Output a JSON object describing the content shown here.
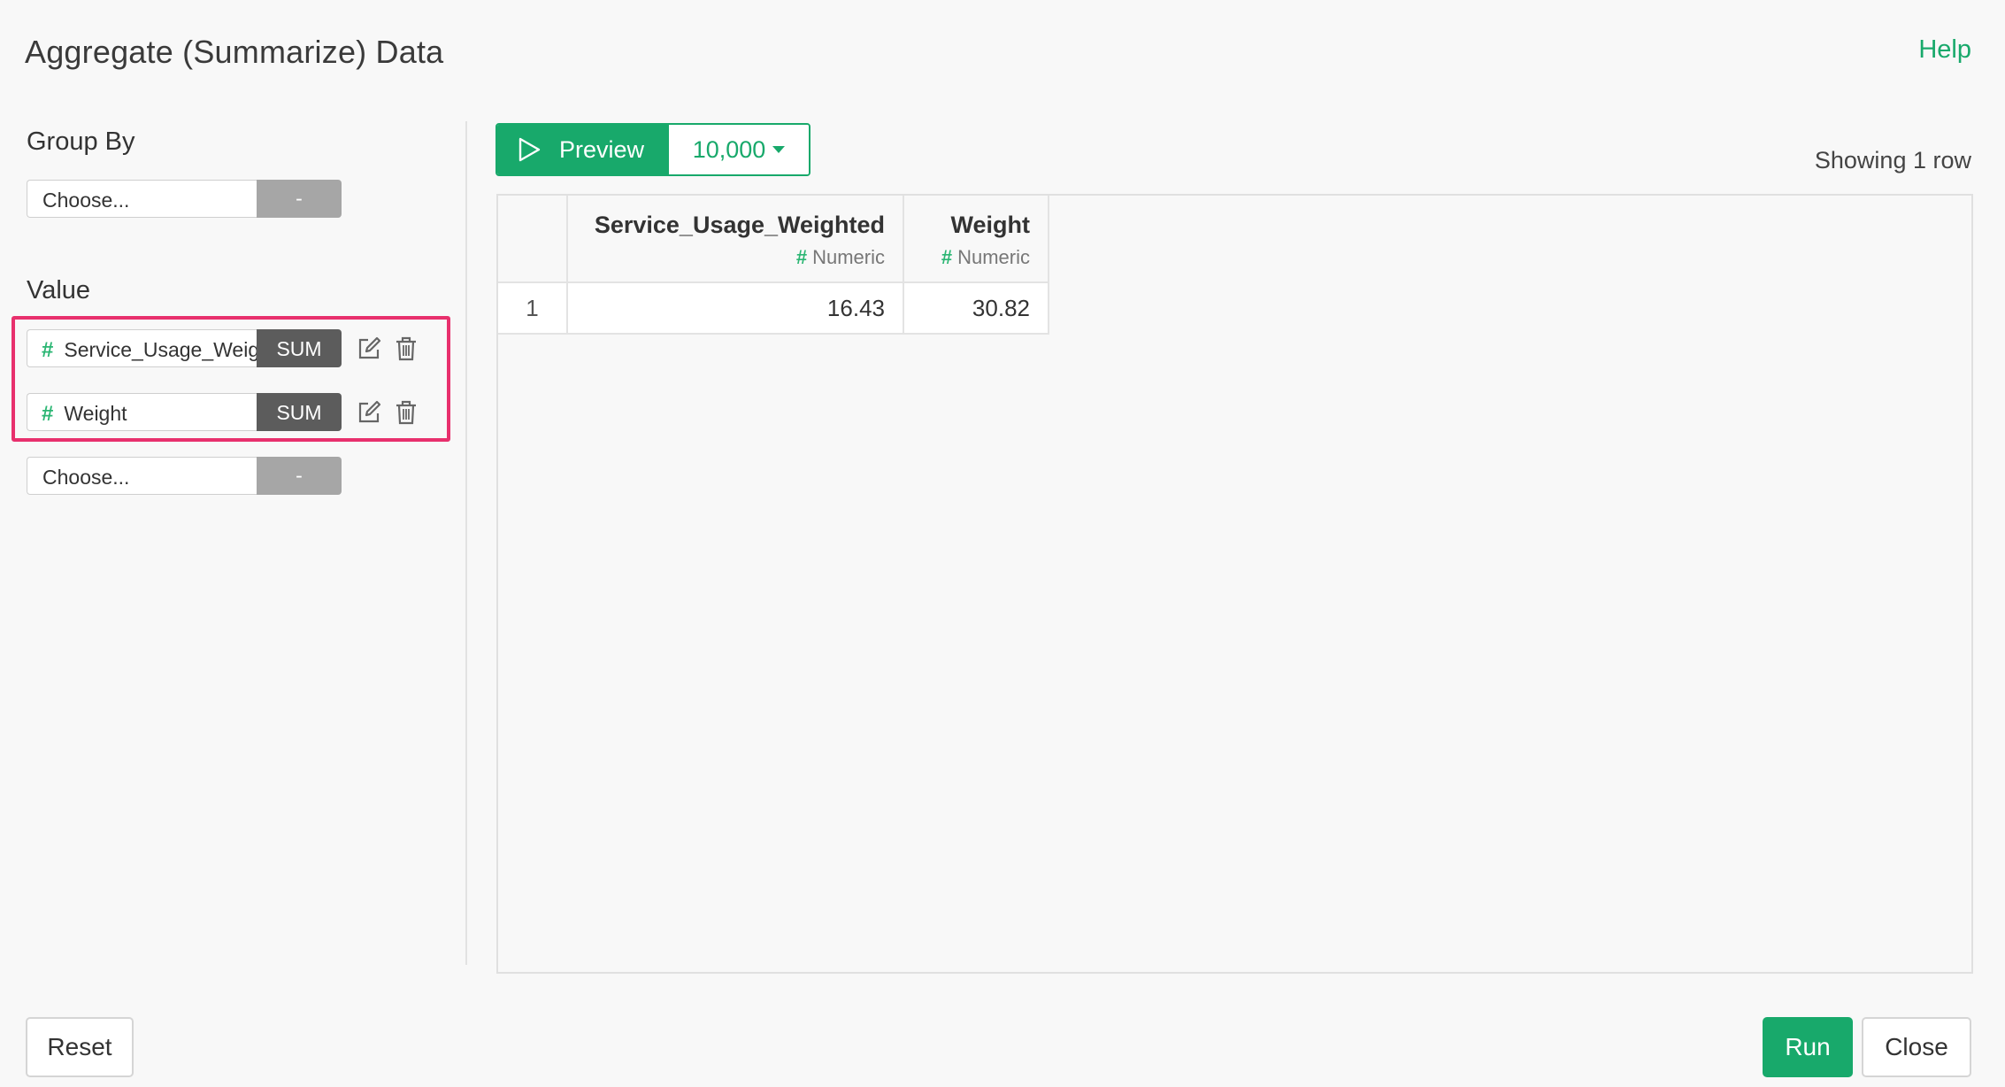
{
  "header": {
    "title": "Aggregate (Summarize) Data",
    "help_label": "Help"
  },
  "group_by": {
    "label": "Group By",
    "selector": {
      "placeholder": "Choose...",
      "function": "-"
    }
  },
  "value": {
    "label": "Value",
    "rows": [
      {
        "type_icon": "#",
        "column": "Service_Usage_Weighted",
        "function": "SUM"
      },
      {
        "type_icon": "#",
        "column": "Weight",
        "function": "SUM"
      }
    ],
    "new_row": {
      "placeholder": "Choose...",
      "function": "-"
    }
  },
  "preview": {
    "button_label": "Preview",
    "row_limit": "10,000",
    "status": "Showing 1 row"
  },
  "table": {
    "columns": [
      {
        "name": "Service_Usage_Weighted",
        "type_icon": "#",
        "type": "Numeric"
      },
      {
        "name": "Weight",
        "type_icon": "#",
        "type": "Numeric"
      }
    ],
    "rows": [
      {
        "index": "1",
        "values": [
          "16.43",
          "30.82"
        ]
      }
    ]
  },
  "footer": {
    "reset_label": "Reset",
    "run_label": "Run",
    "close_label": "Close"
  },
  "colors": {
    "accent": "#18a96b",
    "highlight": "#e8306d",
    "agg_button": "#5c5c5c",
    "disabled_button": "#a6a6a6"
  }
}
